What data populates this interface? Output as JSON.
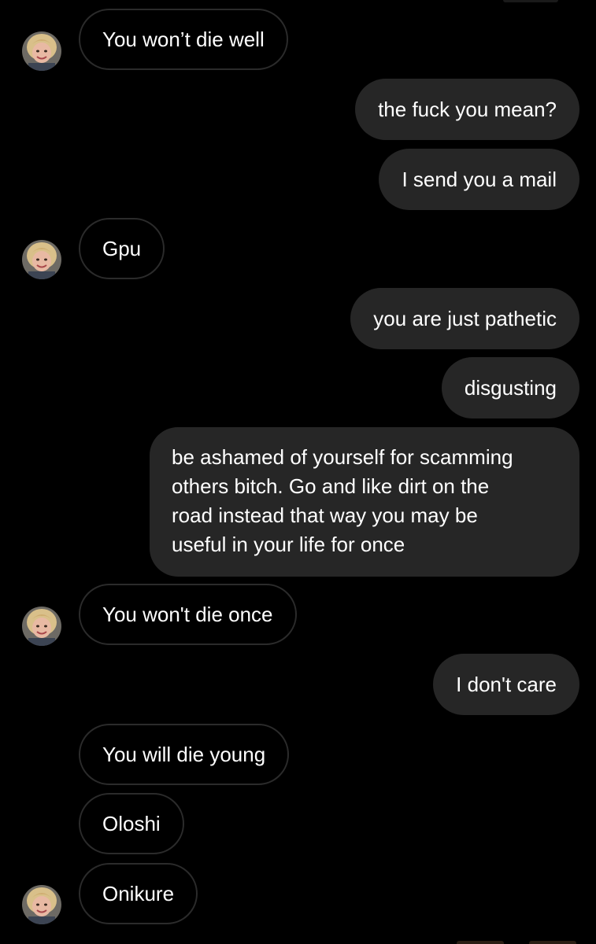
{
  "messages": [
    {
      "sender": "them",
      "text": "You won’t die well"
    },
    {
      "sender": "me",
      "text": "the fuck you mean?"
    },
    {
      "sender": "me",
      "text": "I send you a mail"
    },
    {
      "sender": "them",
      "text": "Gpu"
    },
    {
      "sender": "me",
      "text": "you are just pathetic"
    },
    {
      "sender": "me",
      "text": "disgusting"
    },
    {
      "sender": "me",
      "lines": [
        "be ashamed of yourself for scamming",
        "others bitch. Go and like dirt on the",
        "road instead that way you may be",
        "useful in your life for once"
      ]
    },
    {
      "sender": "them",
      "text": "You won't die once"
    },
    {
      "sender": "me",
      "text": "I don't care"
    },
    {
      "sender": "them",
      "text": "You will die  young"
    },
    {
      "sender": "them",
      "text": "Oloshi"
    },
    {
      "sender": "them",
      "text": "Onikure"
    }
  ],
  "colors": {
    "background": "#000000",
    "outgoing_bubble": "#262626",
    "incoming_border": "#2b2b2b",
    "text": "#ffffff"
  },
  "icons": {
    "contact_avatar": "avatar-icon"
  }
}
